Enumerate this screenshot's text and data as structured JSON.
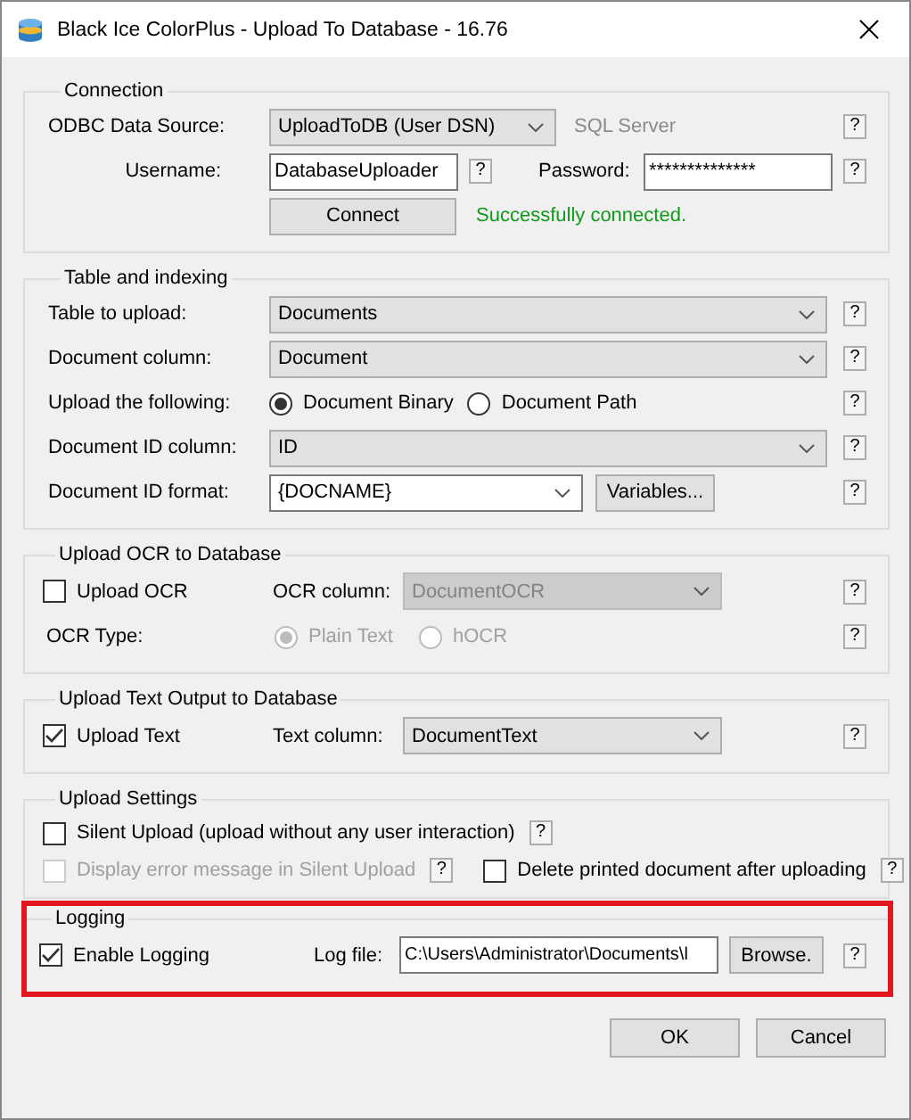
{
  "window": {
    "title": "Black Ice ColorPlus - Upload To Database - 16.76"
  },
  "connection": {
    "title": "Connection",
    "data_source_label": "ODBC Data Source:",
    "data_source": "UploadToDB (User DSN)",
    "driver": "SQL Server",
    "data_source_help": "?",
    "username_label": "Username:",
    "username": "DatabaseUploader",
    "username_help": "?",
    "password_label": "Password:",
    "password": "**************",
    "password_help": "?",
    "connect_button": "Connect",
    "status": "Successfully connected."
  },
  "table": {
    "title": "Table and indexing",
    "rows": [
      {
        "kind": "select",
        "label": "Table to upload:",
        "value": "Documents",
        "help": "?"
      },
      {
        "kind": "select",
        "label": "Document column:",
        "value": "Document",
        "help": "?"
      },
      {
        "kind": "radio",
        "label": "Upload the following:",
        "options": [
          {
            "label": "Document Binary",
            "selected": true
          },
          {
            "label": "Document Path",
            "selected": false
          }
        ],
        "help": "?"
      },
      {
        "kind": "select",
        "label": "Document ID column:",
        "value": "ID",
        "help": "?"
      },
      {
        "kind": "combo",
        "label": "Document ID format:",
        "value": "{DOCNAME}",
        "button": "Variables...",
        "help": "?"
      }
    ]
  },
  "ocr": {
    "title": "Upload OCR to Database",
    "upload": {
      "label": "Upload OCR",
      "checked": false
    },
    "column_label": "OCR column:",
    "column_value": "DocumentOCR",
    "column_disabled": true,
    "column_help": "?",
    "type_label": "OCR Type:",
    "type_disabled": true,
    "type_options": [
      {
        "label": "Plain Text",
        "selected": true
      },
      {
        "label": "hOCR",
        "selected": false
      }
    ],
    "type_help": "?"
  },
  "text_output": {
    "title": "Upload Text Output to Database",
    "upload": {
      "label": "Upload Text",
      "checked": true
    },
    "column_label": "Text column:",
    "column_value": "DocumentText",
    "help": "?"
  },
  "settings": {
    "title": "Upload Settings",
    "rows": [
      [
        {
          "label": "Silent Upload (upload without any user interaction)",
          "checked": false,
          "disabled": false,
          "help": "?"
        }
      ],
      [
        {
          "label": "Display error message in Silent Upload",
          "checked": false,
          "disabled": true,
          "help": "?"
        },
        {
          "label": "Delete printed document after uploading",
          "checked": false,
          "disabled": false,
          "help": "?"
        }
      ]
    ]
  },
  "logging": {
    "title": "Logging",
    "highlighted": true,
    "enable": {
      "label": "Enable Logging",
      "checked": true
    },
    "file_label": "Log file:",
    "file_value": "C:\\Users\\Administrator\\Documents\\l",
    "browse_button": "Browse.",
    "help": "?"
  },
  "buttons": [
    {
      "label": "OK"
    },
    {
      "label": "Cancel"
    }
  ]
}
